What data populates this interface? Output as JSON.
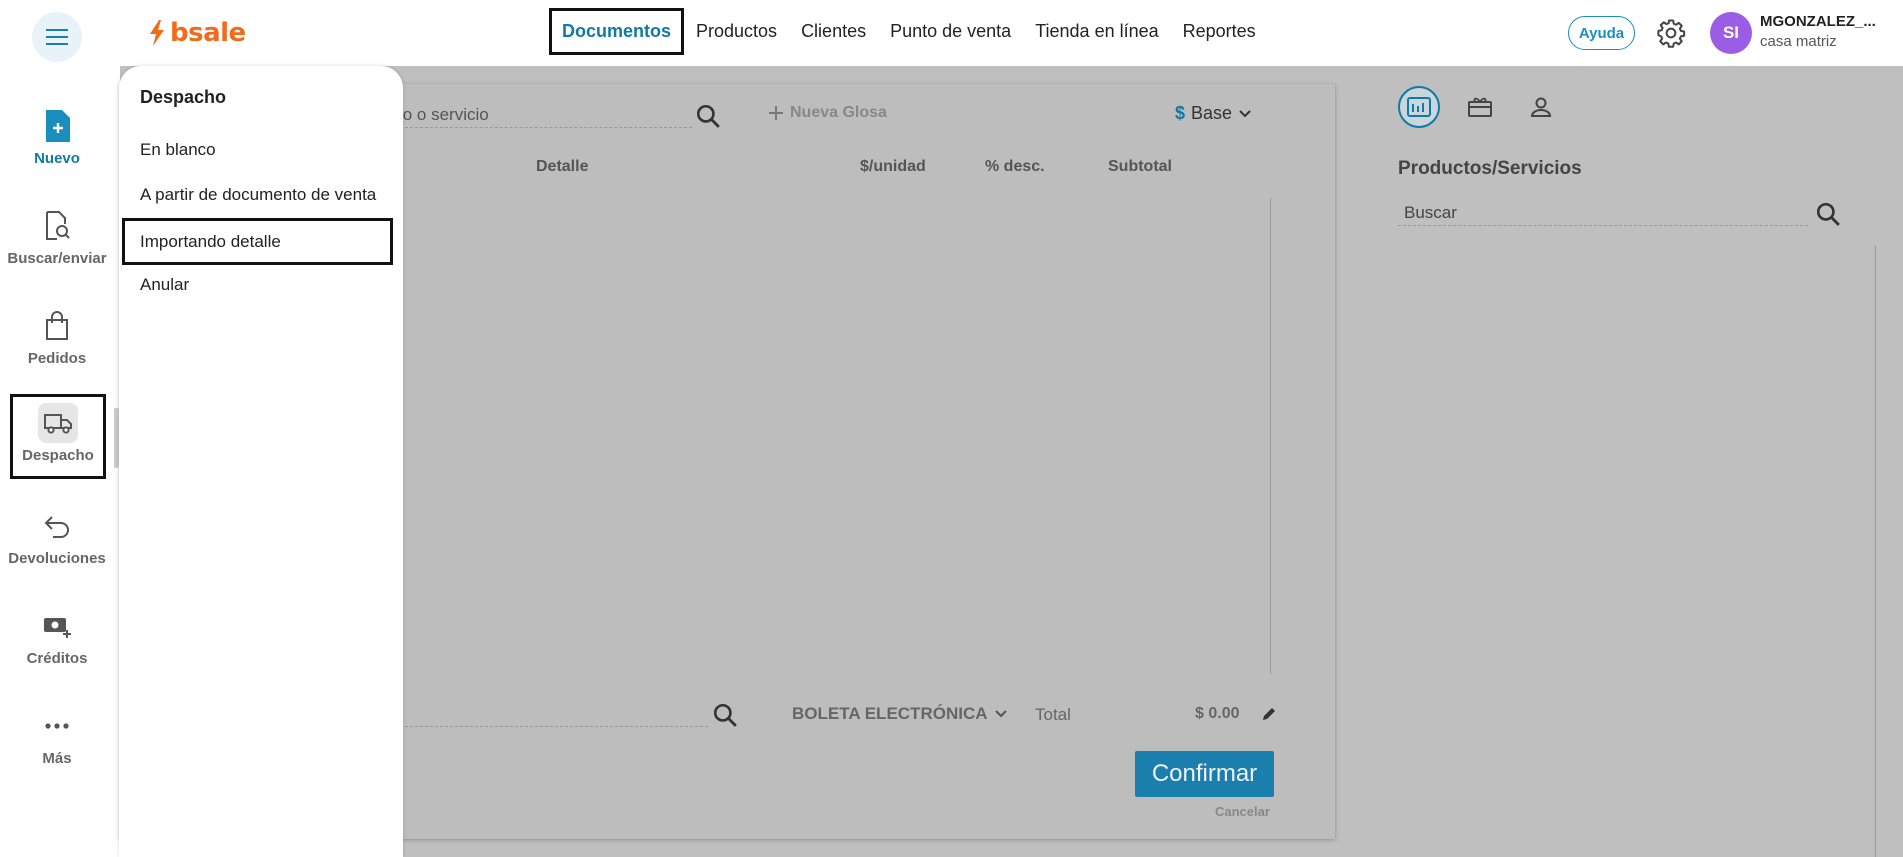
{
  "app": {
    "logo_text": "bsale"
  },
  "topnav": {
    "items": [
      "Documentos",
      "Productos",
      "Clientes",
      "Punto de venta",
      "Tienda en línea",
      "Reportes"
    ],
    "active": "Documentos"
  },
  "header": {
    "help_label": "Ayuda",
    "avatar_initials": "SI",
    "user_name": "MGONZALEZ_...",
    "branch": "casa matriz"
  },
  "sidebar": {
    "items": [
      {
        "label": "Nuevo",
        "icon": "new-document-icon"
      },
      {
        "label": "Buscar/enviar",
        "icon": "search-document-icon"
      },
      {
        "label": "Pedidos",
        "icon": "shopping-bag-icon"
      },
      {
        "label": "Despacho",
        "icon": "truck-icon"
      },
      {
        "label": "Devoluciones",
        "icon": "return-arrow-icon"
      },
      {
        "label": "Créditos",
        "icon": "money-plus-icon"
      },
      {
        "label": "Más",
        "icon": "more-dots-icon"
      }
    ],
    "active": "Despacho"
  },
  "dropdown": {
    "title": "Despacho",
    "items": [
      "En blanco",
      "A partir de documento de venta",
      "Importando detalle",
      "Anular"
    ],
    "selected": "Importando detalle"
  },
  "main": {
    "search_placeholder": "to o servicio",
    "nueva_glosa_label": "Nueva Glosa",
    "price_list": {
      "currency_symbol": "$",
      "value": "Base"
    },
    "columns": [
      "Detalle",
      "$/unidad",
      "% desc.",
      "Subtotal"
    ],
    "document_type": "BOLETA ELECTRÓNICA",
    "total_label": "Total",
    "total_value": "$ 0.00",
    "confirm_label": "Confirmar",
    "cancel_label": "Cancelar"
  },
  "right_panel": {
    "title": "Productos/Servicios",
    "search_placeholder": "Buscar"
  },
  "colors": {
    "brand_orange": "#f26a1b",
    "accent_blue": "#1179a6",
    "avatar_purple": "#9b5de5",
    "overlay_gray": "#bfbfbf"
  }
}
